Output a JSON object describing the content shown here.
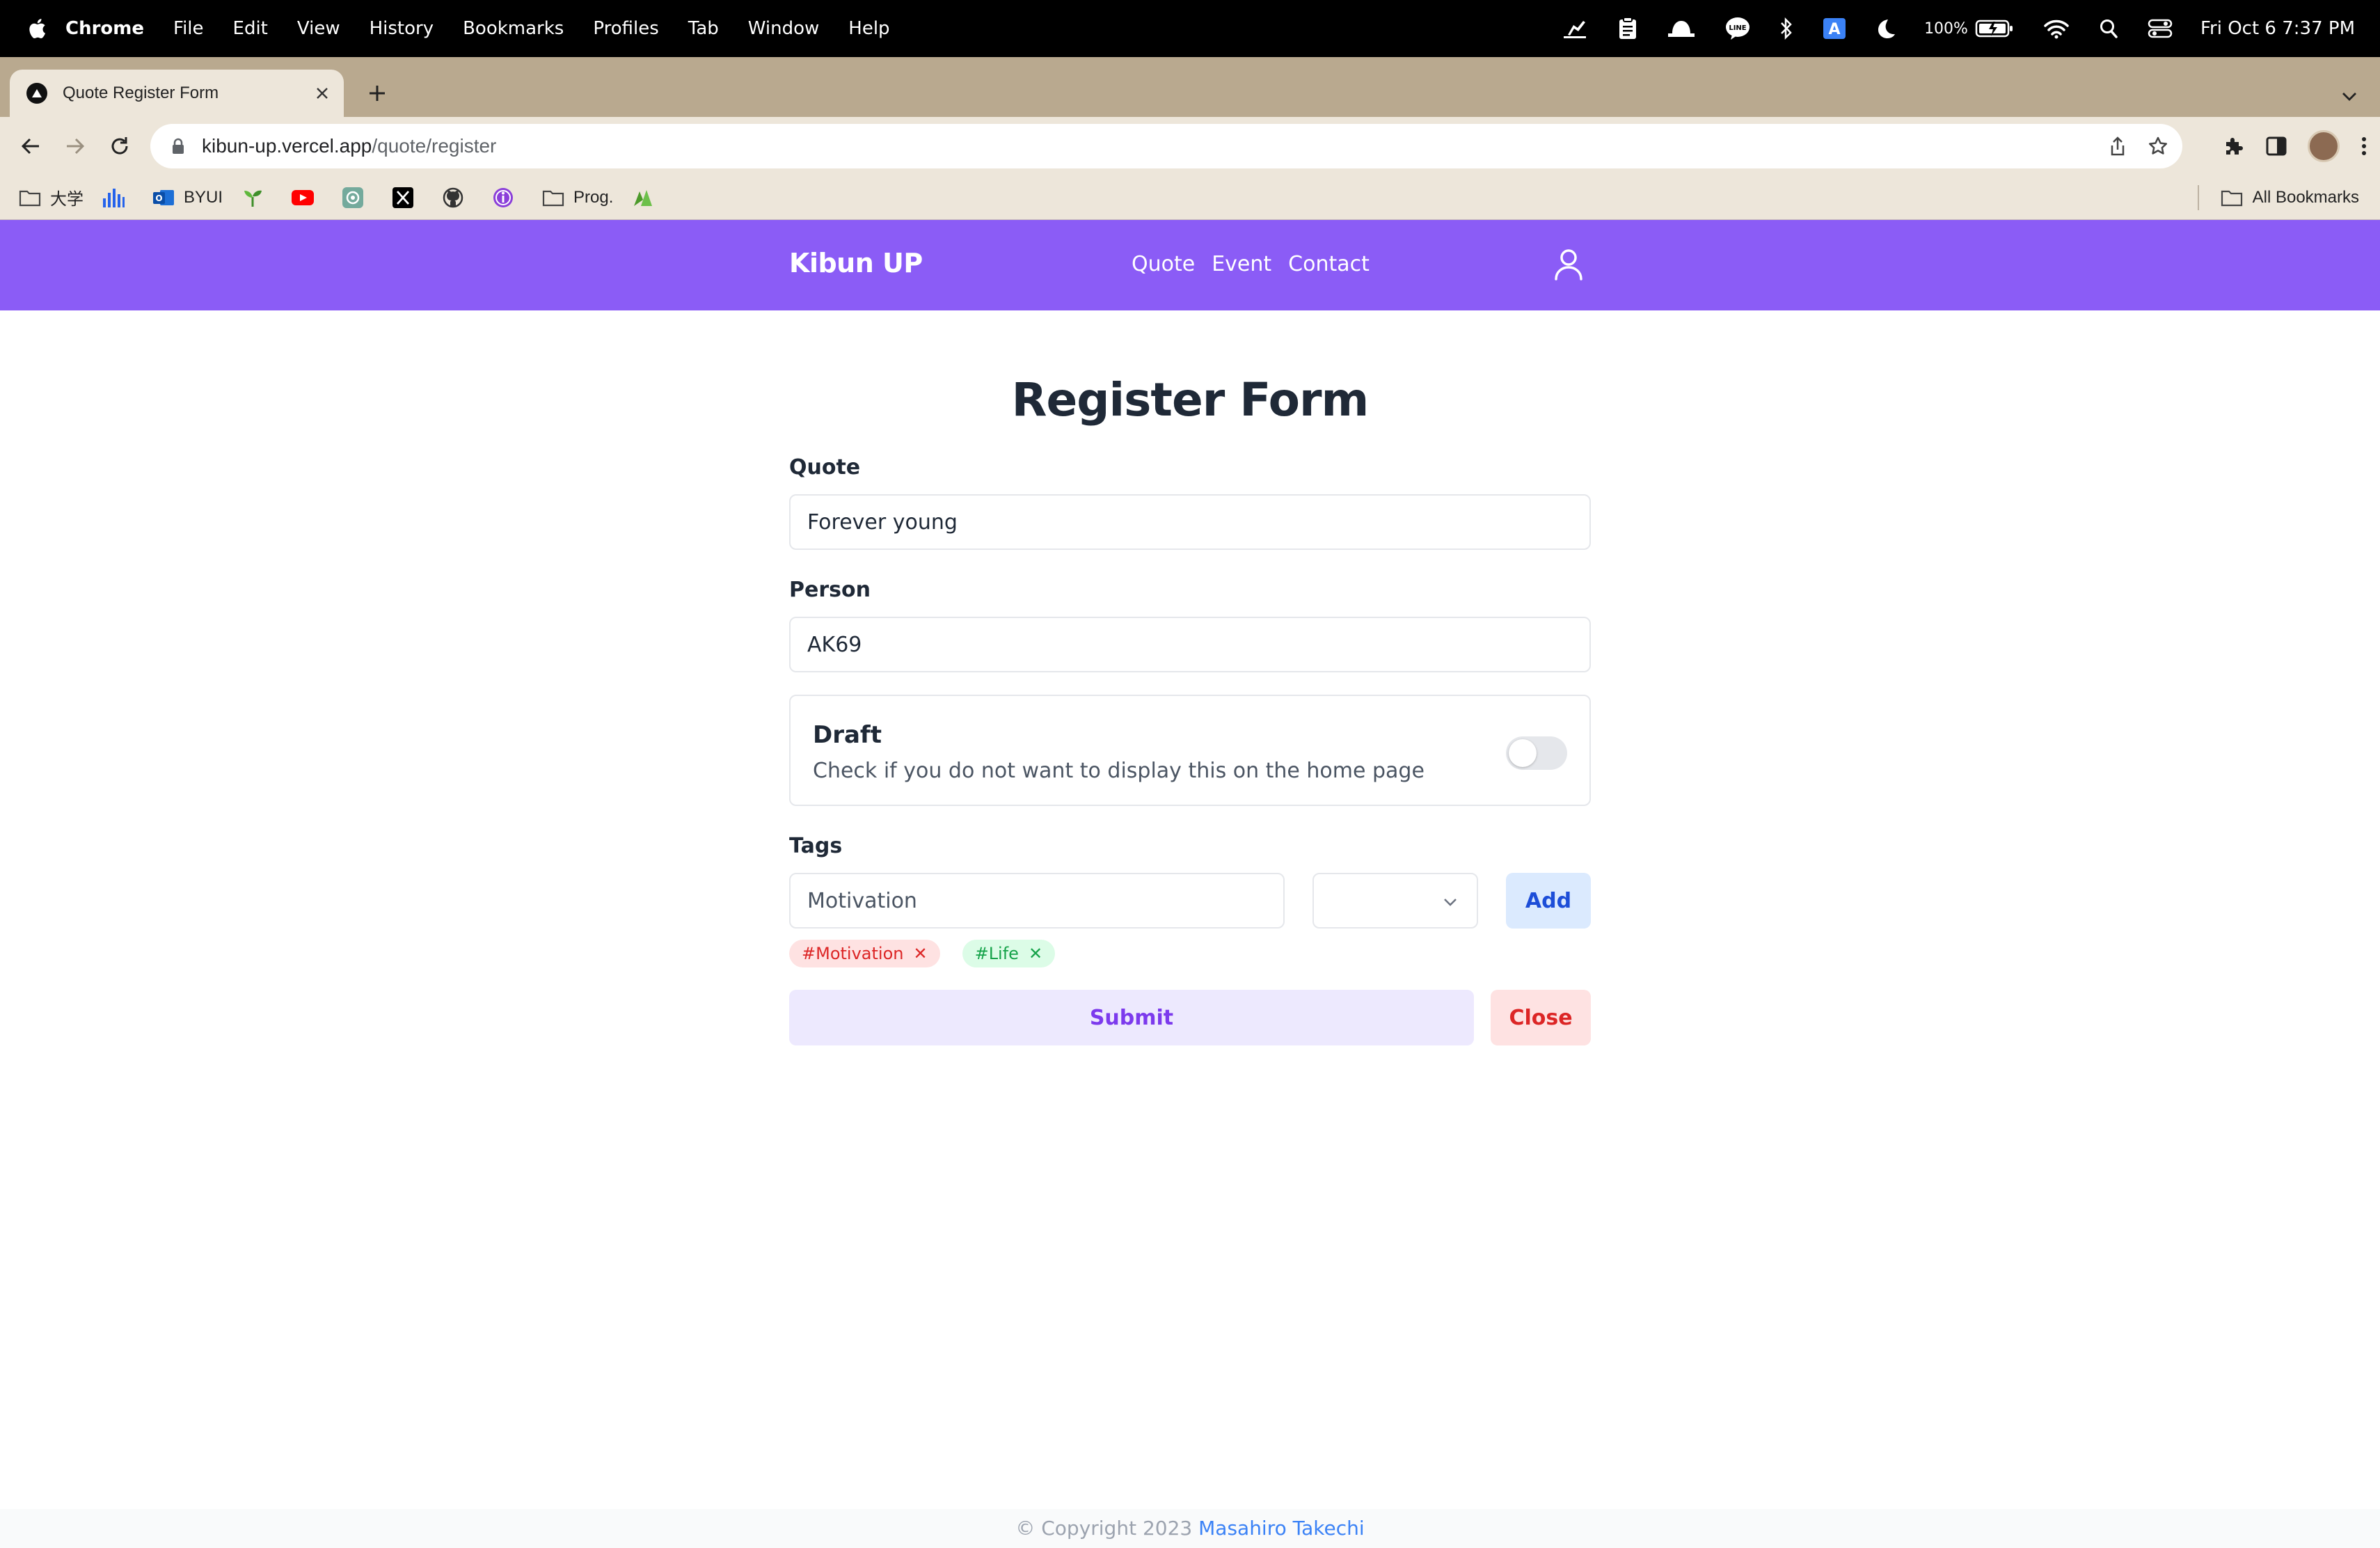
{
  "menubar": {
    "app": "Chrome",
    "items": [
      "File",
      "Edit",
      "View",
      "History",
      "Bookmarks",
      "Profiles",
      "Tab",
      "Window",
      "Help"
    ],
    "battery": "100%",
    "clock": "Fri Oct 6  7:37 PM"
  },
  "browser": {
    "tab_title": "Quote Register Form",
    "url_host": "kibun-up.vercel.app",
    "url_path": "/quote/register",
    "bookmarks": [
      {
        "label": "大学",
        "icon": "folder-icon"
      },
      {
        "label": "",
        "icon": "chart-icon"
      },
      {
        "label": "BYUI",
        "icon": "outlook-icon"
      },
      {
        "label": "",
        "icon": "sprout-icon"
      },
      {
        "label": "",
        "icon": "youtube-icon"
      },
      {
        "label": "",
        "icon": "chatgpt-icon"
      },
      {
        "label": "",
        "icon": "x-icon"
      },
      {
        "label": "",
        "icon": "github-icon"
      },
      {
        "label": "",
        "icon": "info-icon"
      },
      {
        "label": "Prog.",
        "icon": "folder-icon"
      },
      {
        "label": "",
        "icon": "vercel-icon"
      }
    ],
    "all_bookmarks": "All Bookmarks"
  },
  "site": {
    "brand": "Kibun UP",
    "nav": [
      "Quote",
      "Event",
      "Contact"
    ],
    "accent": "#8b5cf6"
  },
  "form": {
    "title": "Register Form",
    "quote_label": "Quote",
    "quote_value": "Forever young",
    "person_label": "Person",
    "person_value": "AK69",
    "draft_title": "Draft",
    "draft_desc": "Check if you do not want to display this on the home page",
    "draft_on": false,
    "tags_label": "Tags",
    "tag_input_value": "Motivation",
    "tag_select_value": "",
    "add_label": "Add",
    "tags": [
      {
        "label": "#Motivation",
        "color": "red"
      },
      {
        "label": "#Life",
        "color": "green"
      }
    ],
    "submit_label": "Submit",
    "close_label": "Close"
  },
  "footer": {
    "copyright": "© Copyright 2023 ",
    "author": "Masahiro Takechi"
  }
}
